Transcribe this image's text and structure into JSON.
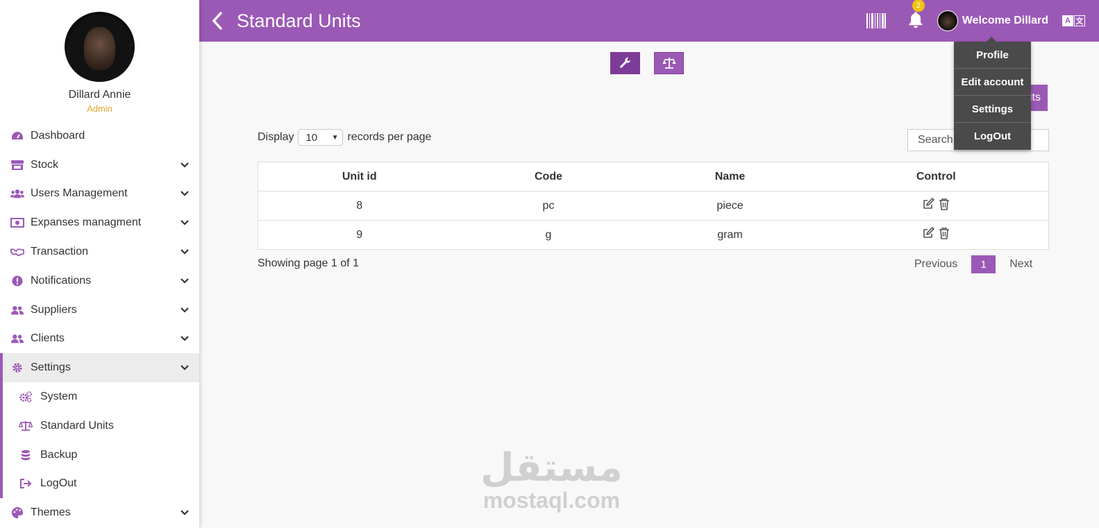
{
  "app": {
    "title": "Standard Units"
  },
  "profile": {
    "name": "Dillard Annie",
    "role": "Admin"
  },
  "sidebar": {
    "items": [
      {
        "label": "Dashboard"
      },
      {
        "label": "Stock"
      },
      {
        "label": "Users Management"
      },
      {
        "label": "Expanses managment"
      },
      {
        "label": "Transaction"
      },
      {
        "label": "Notifications"
      },
      {
        "label": "Suppliers"
      },
      {
        "label": "Clients"
      },
      {
        "label": "Settings"
      },
      {
        "label": "System"
      },
      {
        "label": "Standard Units"
      },
      {
        "label": "Backup"
      },
      {
        "label": "LogOut"
      },
      {
        "label": "Themes"
      }
    ]
  },
  "header": {
    "notification_count": "2",
    "welcome": "Welcome Dillard"
  },
  "user_menu": {
    "items": [
      "Profile",
      "Edit account",
      "Settings",
      "LogOut"
    ]
  },
  "toolbar": {
    "add_label": "its"
  },
  "table_controls": {
    "display_label": "Display",
    "records_per_page": "10",
    "records_label": "records per page",
    "search_placeholder": "Search"
  },
  "table": {
    "columns": [
      "Unit id",
      "Code",
      "Name",
      "Control"
    ],
    "rows": [
      {
        "id": "8",
        "code": "pc",
        "name": "piece"
      },
      {
        "id": "9",
        "code": "g",
        "name": "gram"
      }
    ]
  },
  "pagination": {
    "showing": "Showing page 1 of 1",
    "previous": "Previous",
    "current": "1",
    "next": "Next"
  },
  "watermark": {
    "arabic": "مستقل",
    "latin": "mostaql.com"
  },
  "colors": {
    "accent": "#9b59b6",
    "accent_dark": "#7d3c98",
    "badge": "#f1c40f",
    "role": "#e0a82e",
    "dropdown_bg": "#4a4a4a"
  }
}
